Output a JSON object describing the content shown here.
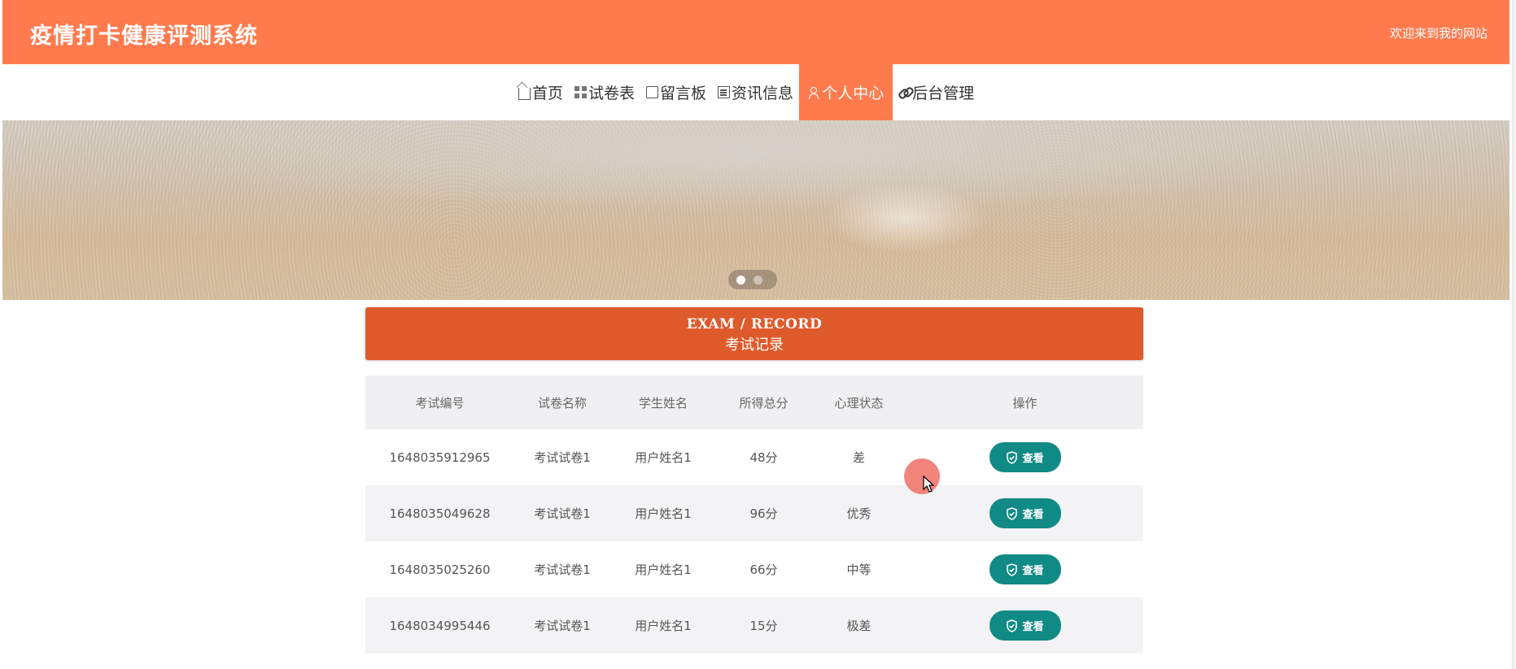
{
  "header": {
    "site_title": "疫情打卡健康评测系统",
    "welcome": "欢迎来到我的网站"
  },
  "nav": {
    "items": [
      {
        "label": "首页",
        "icon": "home-icon"
      },
      {
        "label": "试卷表",
        "icon": "grid-icon"
      },
      {
        "label": "留言板",
        "icon": "message-icon"
      },
      {
        "label": "资讯信息",
        "icon": "news-icon"
      },
      {
        "label": "个人中心",
        "icon": "user-icon",
        "active": true
      },
      {
        "label": "后台管理",
        "icon": "link-icon"
      }
    ]
  },
  "banner": {
    "slide_count": 2,
    "active_slide": 1
  },
  "section": {
    "title_en": "EXAM / RECORD",
    "title_zh": "考试记录"
  },
  "table": {
    "columns": [
      "考试编号",
      "试卷名称",
      "学生姓名",
      "所得总分",
      "心理状态",
      "操作"
    ],
    "rows": [
      {
        "id": "1648035912965",
        "paper": "考试试卷1",
        "student": "用户姓名1",
        "score": "48分",
        "status": "差",
        "action": "查看"
      },
      {
        "id": "1648035049628",
        "paper": "考试试卷1",
        "student": "用户姓名1",
        "score": "96分",
        "status": "优秀",
        "action": "查看"
      },
      {
        "id": "1648035025260",
        "paper": "考试试卷1",
        "student": "用户姓名1",
        "score": "66分",
        "status": "中等",
        "action": "查看"
      },
      {
        "id": "1648034995446",
        "paper": "考试试卷1",
        "student": "用户姓名1",
        "score": "15分",
        "status": "极差",
        "action": "查看"
      }
    ]
  },
  "colors": {
    "header_bg": "#ff7b4e",
    "nav_active_bg": "#ff7b4e",
    "section_bar_bg": "#de5a2b",
    "view_button_bg": "#108a85"
  }
}
